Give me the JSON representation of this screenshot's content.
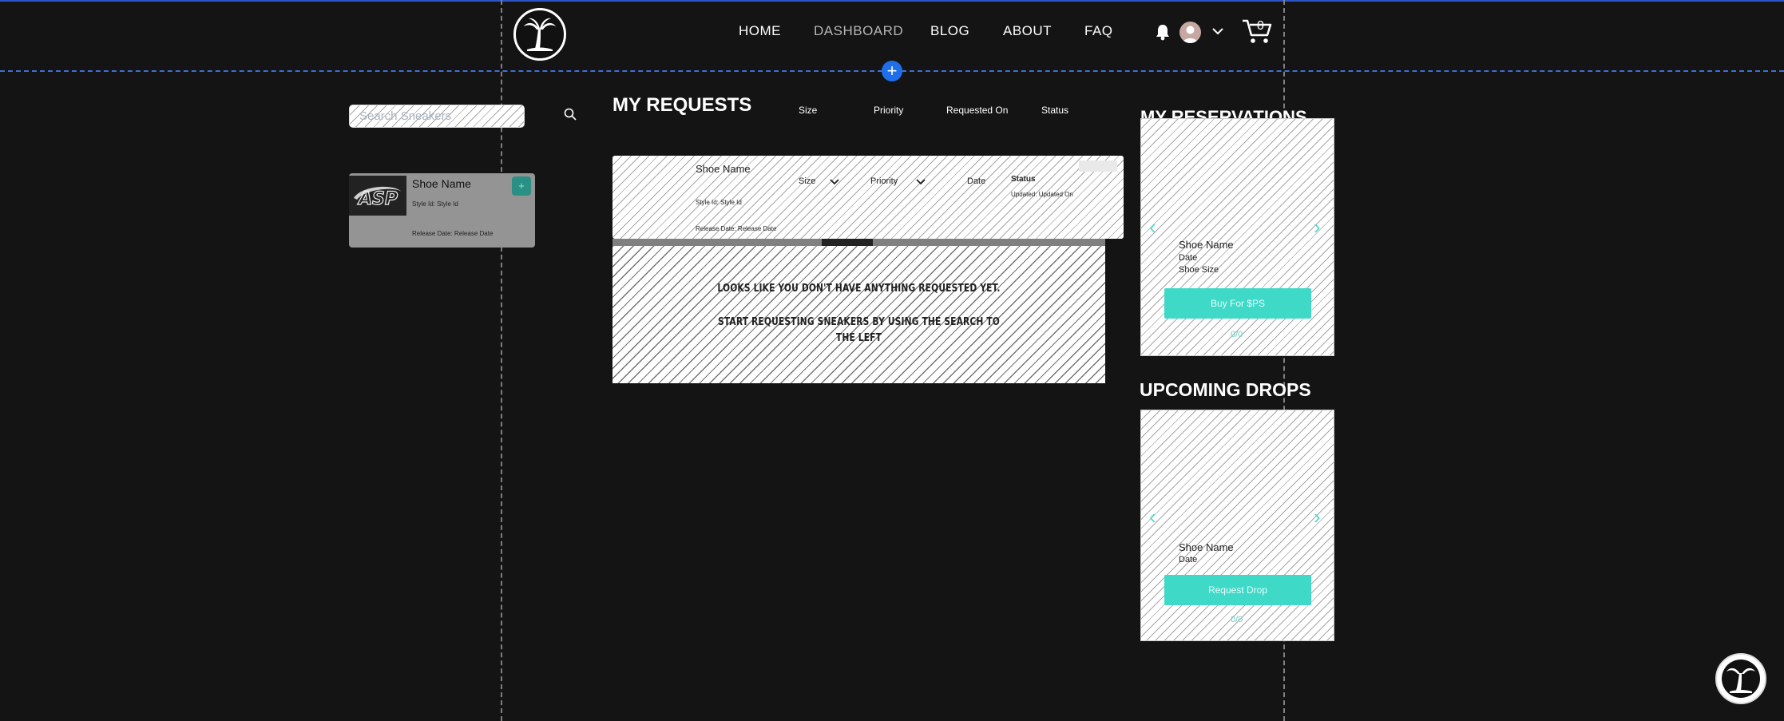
{
  "nav": {
    "items": [
      "HOME",
      "DASHBOARD",
      "BLOG",
      "ABOUT",
      "FAQ"
    ],
    "active": "DASHBOARD",
    "cart_count": "0"
  },
  "search": {
    "placeholder": "Search Sneakers"
  },
  "result_card": {
    "brand_logo_text": "ASP",
    "name": "Shoe Name",
    "style": "Style Id:   Style Id",
    "release": "Release Date:      Release Date"
  },
  "requests": {
    "title": "MY REQUESTS",
    "columns": [
      "Size",
      "Priority",
      "Requested On",
      "Status"
    ],
    "row": {
      "name": "Shoe Name",
      "style": "Style Id:   Style Id",
      "release": "Release Date:   Release Date",
      "size": "Size",
      "priority": "Priority",
      "date": "Date",
      "status_label": "Status",
      "updated": "Updated:  Updated On"
    },
    "empty_line1": "LOOKS LIKE YOU DON'T HAVE ANYTHING REQUESTED YET.",
    "empty_line2": "START REQUESTING SNEAKERS BY USING THE SEARCH TO",
    "empty_line3": "THE LEFT"
  },
  "reservations": {
    "title": "MY RESERVATIONS",
    "name": "Shoe Name",
    "date": "Date",
    "size": "Shoe Size",
    "button": "Buy For $PS",
    "pager": "0/0"
  },
  "drops": {
    "title": "UPCOMING DROPS",
    "name": "Shoe Name",
    "date": "Date",
    "button": "Request Drop",
    "pager": "0/0"
  },
  "colors": {
    "background": "#141414",
    "accent_teal": "#3fd9c8",
    "editor_blue": "#1f6feb"
  }
}
